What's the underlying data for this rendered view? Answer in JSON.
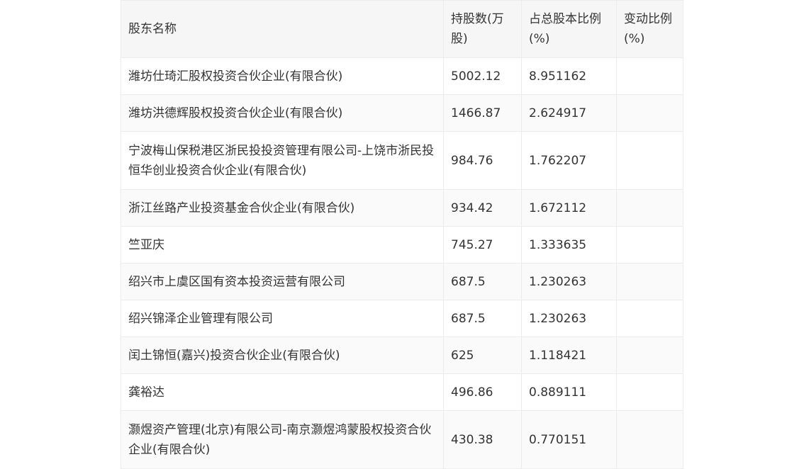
{
  "table": {
    "headers": [
      "股东名称",
      "持股数(万股)",
      "占总股本比例(%)",
      "变动比例(%)"
    ],
    "rows": [
      [
        "潍坊仕琦汇股权投资合伙企业(有限合伙)",
        "5002.12",
        "8.951162",
        ""
      ],
      [
        "潍坊洪德辉股权投资合伙企业(有限合伙)",
        "1466.87",
        "2.624917",
        ""
      ],
      [
        "宁波梅山保税港区浙民投投资管理有限公司-上饶市浙民投恒华创业投资合伙企业(有限合伙)",
        "984.76",
        "1.762207",
        ""
      ],
      [
        "浙江丝路产业投资基金合伙企业(有限合伙)",
        "934.42",
        "1.672112",
        ""
      ],
      [
        "竺亚庆",
        "745.27",
        "1.333635",
        ""
      ],
      [
        "绍兴市上虞区国有资本投资运营有限公司",
        "687.5",
        "1.230263",
        ""
      ],
      [
        "绍兴锦泽企业管理有限公司",
        "687.5",
        "1.230263",
        ""
      ],
      [
        "闰土锦恒(嘉兴)投资合伙企业(有限合伙)",
        "625",
        "1.118421",
        ""
      ],
      [
        "龚裕达",
        "496.86",
        "0.889111",
        ""
      ],
      [
        "灏煜资产管理(北京)有限公司-南京灏煜鸿蒙股权投资合伙企业(有限合伙)",
        "430.38",
        "0.770151",
        ""
      ]
    ]
  }
}
